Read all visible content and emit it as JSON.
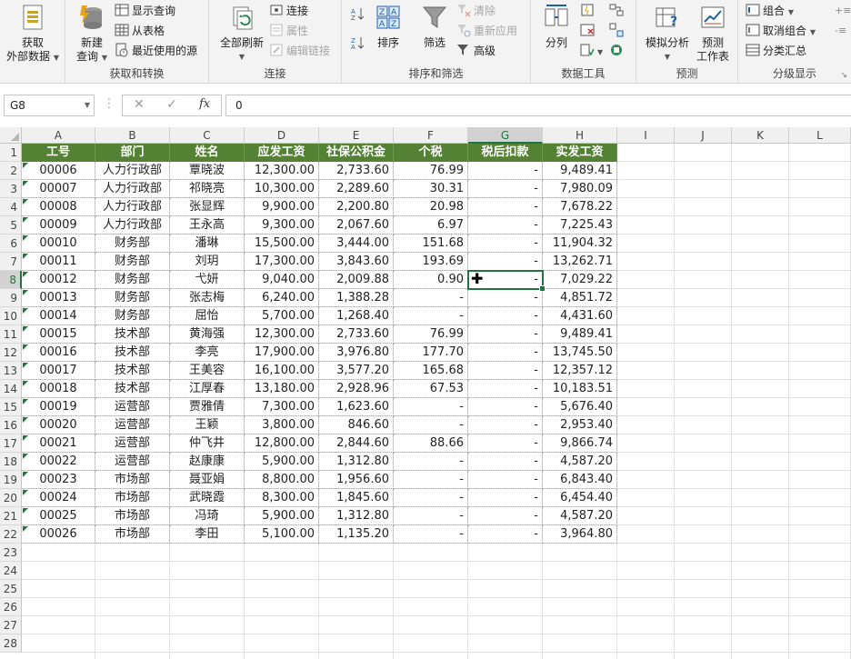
{
  "ribbon": {
    "get_data": {
      "line1": "获取",
      "line2": "外部数据"
    },
    "new_query": {
      "line1": "新建",
      "line2": "查询"
    },
    "show_queries": "显示查询",
    "from_table": "从表格",
    "recent_sources": "最近使用的源",
    "group_get_transform": "获取和转换",
    "refresh_all": "全部刷新",
    "connections": "连接",
    "properties": "属性",
    "edit_links": "编辑链接",
    "group_connections": "连接",
    "sort": "排序",
    "filter": "筛选",
    "clear": "清除",
    "reapply": "重新应用",
    "advanced": "高级",
    "group_sort_filter": "排序和筛选",
    "text_to_columns": "分列",
    "group_data_tools": "数据工具",
    "what_if": "模拟分析",
    "forecast_sheet": {
      "line1": "预测",
      "line2": "工作表"
    },
    "group_forecast": "预测",
    "group_btn": "组合",
    "ungroup": "取消组合",
    "subtotal": "分类汇总",
    "group_outline": "分级显示"
  },
  "formula_bar": {
    "name_box": "G8",
    "cancel": "✕",
    "enter": "✓",
    "fx": "fx",
    "value": "0"
  },
  "columns": [
    "A",
    "B",
    "C",
    "D",
    "E",
    "F",
    "G",
    "H",
    "I",
    "J",
    "K",
    "L"
  ],
  "selected_column": "G",
  "selected_row": "8",
  "rows": [
    "1",
    "2",
    "3",
    "4",
    "5",
    "6",
    "7",
    "8",
    "9",
    "10",
    "11",
    "12",
    "13",
    "14",
    "15",
    "16",
    "17",
    "18",
    "19",
    "20",
    "21",
    "22",
    "23",
    "24",
    "25",
    "26",
    "27",
    "28"
  ],
  "table_headers": [
    "工号",
    "部门",
    "姓名",
    "应发工资",
    "社保公积金",
    "个税",
    "税后扣款",
    "实发工资"
  ],
  "table_rows": [
    [
      "00006",
      "人力行政部",
      "覃晓波",
      "12,300.00",
      "2,733.60",
      "76.99",
      "-",
      "9,489.41"
    ],
    [
      "00007",
      "人力行政部",
      "祁晓亮",
      "10,300.00",
      "2,289.60",
      "30.31",
      "-",
      "7,980.09"
    ],
    [
      "00008",
      "人力行政部",
      "张显辉",
      "9,900.00",
      "2,200.80",
      "20.98",
      "-",
      "7,678.22"
    ],
    [
      "00009",
      "人力行政部",
      "王永高",
      "9,300.00",
      "2,067.60",
      "6.97",
      "-",
      "7,225.43"
    ],
    [
      "00010",
      "财务部",
      "潘琳",
      "15,500.00",
      "3,444.00",
      "151.68",
      "-",
      "11,904.32"
    ],
    [
      "00011",
      "财务部",
      "刘玥",
      "17,300.00",
      "3,843.60",
      "193.69",
      "-",
      "13,262.71"
    ],
    [
      "00012",
      "财务部",
      "弋妍",
      "9,040.00",
      "2,009.88",
      "0.90",
      "-",
      "7,029.22"
    ],
    [
      "00013",
      "财务部",
      "张志梅",
      "6,240.00",
      "1,388.28",
      "-",
      "-",
      "4,851.72"
    ],
    [
      "00014",
      "财务部",
      "屈怡",
      "5,700.00",
      "1,268.40",
      "-",
      "-",
      "4,431.60"
    ],
    [
      "00015",
      "技术部",
      "黄海强",
      "12,300.00",
      "2,733.60",
      "76.99",
      "-",
      "9,489.41"
    ],
    [
      "00016",
      "技术部",
      "李亮",
      "17,900.00",
      "3,976.80",
      "177.70",
      "-",
      "13,745.50"
    ],
    [
      "00017",
      "技术部",
      "王美容",
      "16,100.00",
      "3,577.20",
      "165.68",
      "-",
      "12,357.12"
    ],
    [
      "00018",
      "技术部",
      "江厚春",
      "13,180.00",
      "2,928.96",
      "67.53",
      "-",
      "10,183.51"
    ],
    [
      "00019",
      "运营部",
      "贾雅倩",
      "7,300.00",
      "1,623.60",
      "-",
      "-",
      "5,676.40"
    ],
    [
      "00020",
      "运营部",
      "王颖",
      "3,800.00",
      "846.60",
      "-",
      "-",
      "2,953.40"
    ],
    [
      "00021",
      "运营部",
      "仲飞井",
      "12,800.00",
      "2,844.60",
      "88.66",
      "-",
      "9,866.74"
    ],
    [
      "00022",
      "运营部",
      "赵康康",
      "5,900.00",
      "1,312.80",
      "-",
      "-",
      "4,587.20"
    ],
    [
      "00023",
      "市场部",
      "聂亚娟",
      "8,800.00",
      "1,956.60",
      "-",
      "-",
      "6,843.40"
    ],
    [
      "00024",
      "市场部",
      "武晓霞",
      "8,300.00",
      "1,845.60",
      "-",
      "-",
      "6,454.40"
    ],
    [
      "00025",
      "市场部",
      "冯琦",
      "5,900.00",
      "1,312.80",
      "-",
      "-",
      "4,587.20"
    ],
    [
      "00026",
      "市场部",
      "李田",
      "5,100.00",
      "1,135.20",
      "-",
      "-",
      "3,964.80"
    ]
  ],
  "colors": {
    "accent": "#217346",
    "header_fill": "#548235",
    "header_text": "#ffffff"
  }
}
